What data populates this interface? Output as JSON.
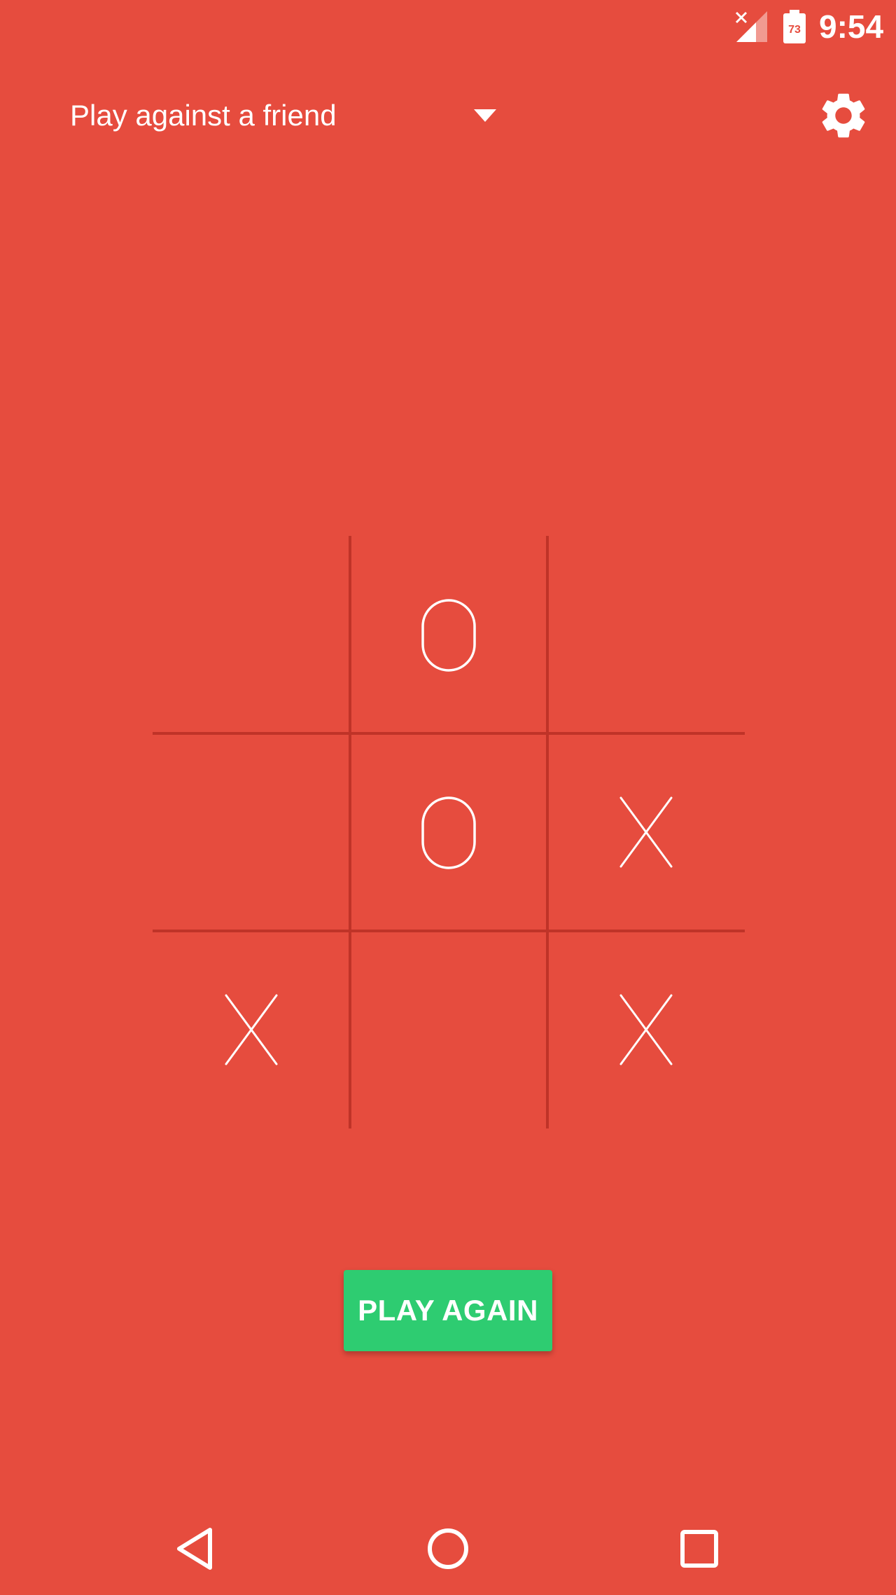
{
  "status_bar": {
    "time": "9:54",
    "battery_level": "73",
    "signal_icon": "signal-no-service-icon",
    "battery_icon": "battery-charging-icon"
  },
  "app_bar": {
    "mode_selected": "Play against a friend",
    "dropdown_icon": "dropdown-arrow-icon",
    "settings_icon": "gear-icon"
  },
  "board": {
    "cells": [
      "",
      "O",
      "",
      "",
      "O",
      "X",
      "X",
      "",
      "X"
    ]
  },
  "actions": {
    "play_again_label": "PLAY AGAIN"
  },
  "nav_bar": {
    "back_icon": "back-triangle-icon",
    "home_icon": "home-circle-icon",
    "recents_icon": "recents-square-icon"
  },
  "colors": {
    "background": "#e64c3e",
    "grid": "#bf3328",
    "mark": "#ffffff",
    "button": "#2ecc71"
  }
}
